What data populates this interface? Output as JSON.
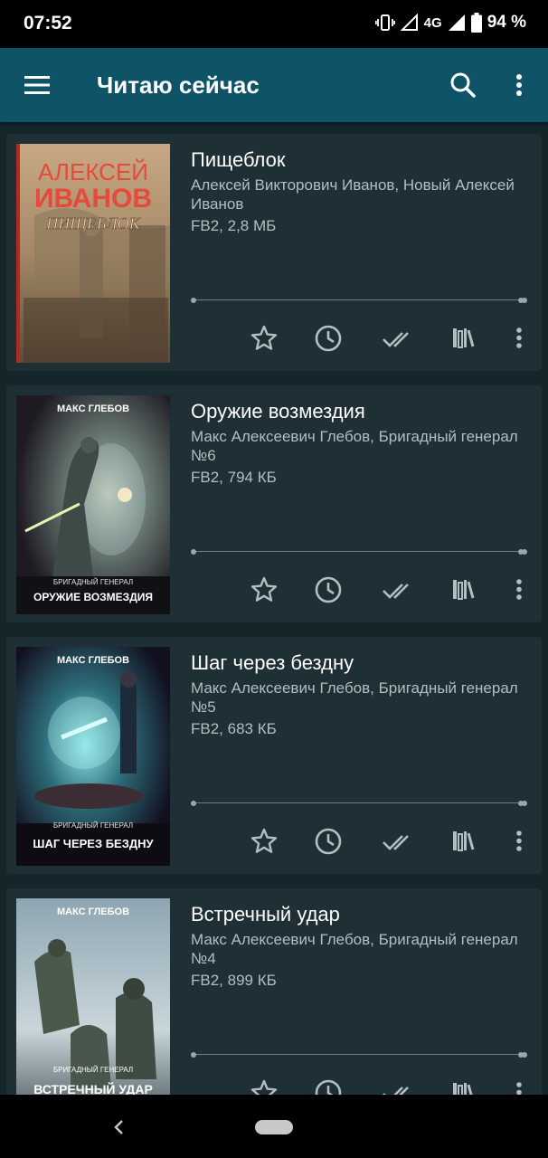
{
  "status": {
    "time": "07:52",
    "network": "4G",
    "battery": "94 %"
  },
  "appbar": {
    "title": "Читаю сейчас"
  },
  "books": [
    {
      "title": "Пищеблок",
      "author": "Алексей Викторович Иванов, Новый Алексей Иванов",
      "meta": "FB2, 2,8 МБ",
      "cover": {
        "top_text": "АЛЕКСЕЙ",
        "main_text": "ИВАНОВ",
        "sub_text": "ПИЩЕБЛОК",
        "bottom_text": ""
      }
    },
    {
      "title": "Оружие возмездия",
      "author": "Макс Алексеевич Глебов, Бригадный генерал №6",
      "meta": "FB2, 794 КБ",
      "cover": {
        "top_text": "МАКС ГЛЕБОВ",
        "series_text": "БРИГАДНЫЙ ГЕНЕРАЛ",
        "bottom_text": "ОРУЖИЕ ВОЗМЕЗДИЯ"
      }
    },
    {
      "title": "Шаг через бездну",
      "author": "Макс Алексеевич Глебов, Бригадный генерал №5",
      "meta": "FB2, 683 КБ",
      "cover": {
        "top_text": "МАКС ГЛЕБОВ",
        "series_text": "БРИГАДНЫЙ ГЕНЕРАЛ",
        "bottom_text": "ШАГ ЧЕРЕЗ БЕЗДНУ"
      }
    },
    {
      "title": "Встречный удар",
      "author": "Макс Алексеевич Глебов, Бригадный генерал №4",
      "meta": "FB2, 899 КБ",
      "cover": {
        "top_text": "МАКС ГЛЕБОВ",
        "series_text": "БРИГАДНЫЙ ГЕНЕРАЛ",
        "bottom_text": "ВСТРЕЧНЫЙ УДАР"
      }
    }
  ],
  "icons": {
    "menu": "hamburger-icon",
    "search": "search-icon",
    "more": "more-vert-icon",
    "favorite": "star-outline-icon",
    "history": "clock-icon",
    "read": "double-check-icon",
    "shelf": "bookshelf-icon",
    "book_more": "more-vert-icon"
  },
  "colors": {
    "appbar": "#0e5366",
    "background": "#15262b",
    "card": "#1e2f35",
    "secondary_text": "#b3bec2"
  }
}
